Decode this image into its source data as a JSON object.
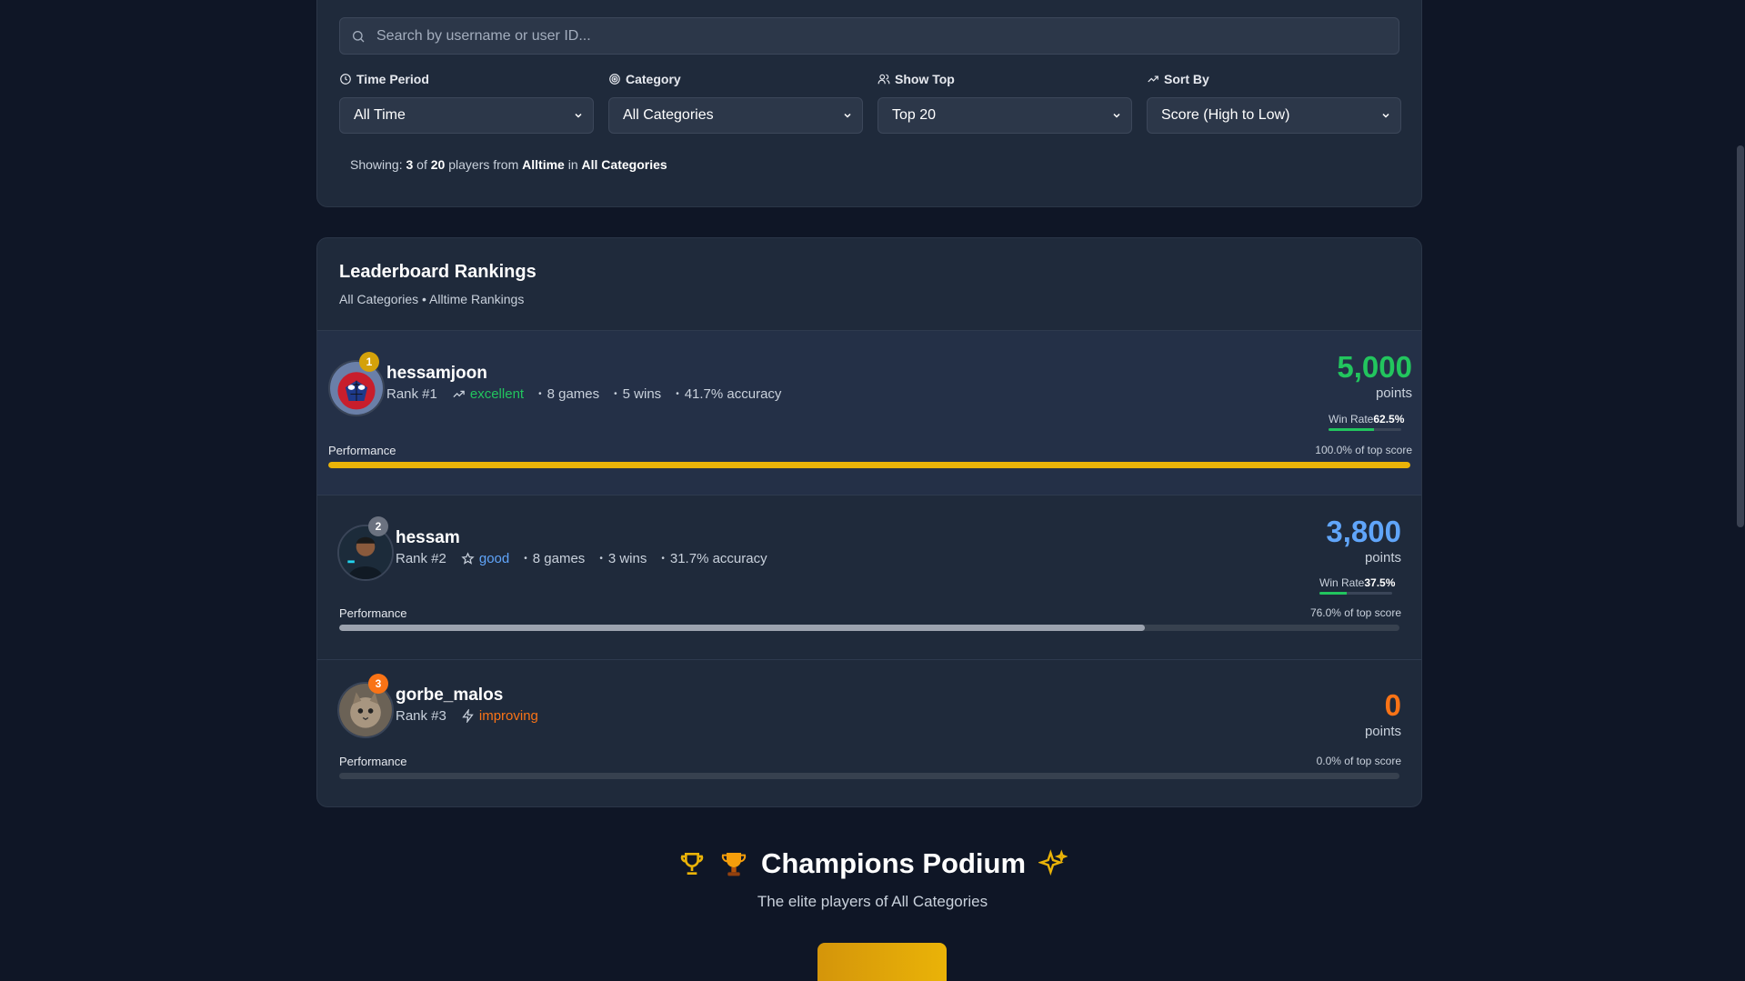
{
  "search": {
    "placeholder": "Search by username or user ID..."
  },
  "filters": [
    {
      "label": "Time Period",
      "value": "All Time",
      "icon": "clock-icon"
    },
    {
      "label": "Category",
      "value": "All Categories",
      "icon": "target-icon"
    },
    {
      "label": "Show Top",
      "value": "Top 20",
      "icon": "users-icon"
    },
    {
      "label": "Sort By",
      "value": "Score (High to Low)",
      "icon": "trending-up-icon"
    }
  ],
  "showing": {
    "prefix": "Showing:",
    "count": "3",
    "of": "of",
    "total": "20",
    "players_from": "players from",
    "period": "Alltime",
    "in": "in",
    "category": "All Categories"
  },
  "leaderboard": {
    "title": "Leaderboard Rankings",
    "subtitle": "All Categories • Alltime Rankings"
  },
  "players": [
    {
      "rank_badge": "1",
      "name": "hessamjoon",
      "rank": "Rank #1",
      "status": "excellent",
      "games": "8 games",
      "wins": "5 wins",
      "accuracy": "41.7% accuracy",
      "score": "5,000",
      "points_label": "points",
      "win_rate_label": "Win Rate",
      "win_rate": "62.5%",
      "win_rate_value": 0.625,
      "performance_label": "Performance",
      "performance_pct": "100.0% of top score",
      "performance_value": 1.0,
      "color": "#22c55e",
      "bar_color": "#eab308",
      "badge_color": "#d4a10a",
      "status_color": "#22c55e"
    },
    {
      "rank_badge": "2",
      "name": "hessam",
      "rank": "Rank #2",
      "status": "good",
      "games": "8 games",
      "wins": "3 wins",
      "accuracy": "31.7% accuracy",
      "score": "3,800",
      "points_label": "points",
      "win_rate_label": "Win Rate",
      "win_rate": "37.5%",
      "win_rate_value": 0.375,
      "performance_label": "Performance",
      "performance_pct": "76.0% of top score",
      "performance_value": 0.76,
      "color": "#60a5fa",
      "bar_color": "#9ca3af",
      "badge_color": "#6b7280",
      "status_color": "#60a5fa"
    },
    {
      "rank_badge": "3",
      "name": "gorbe_malos",
      "rank": "Rank #3",
      "status": "improving",
      "score": "0",
      "points_label": "points",
      "performance_label": "Performance",
      "performance_pct": "0.0% of top score",
      "performance_value": 0.0,
      "color": "#f97316",
      "bar_color": "#f97316",
      "badge_color": "#f97316",
      "status_color": "#f97316"
    }
  ],
  "podium": {
    "title": "Champions Podium",
    "subtitle": "The elite players of All Categories"
  }
}
